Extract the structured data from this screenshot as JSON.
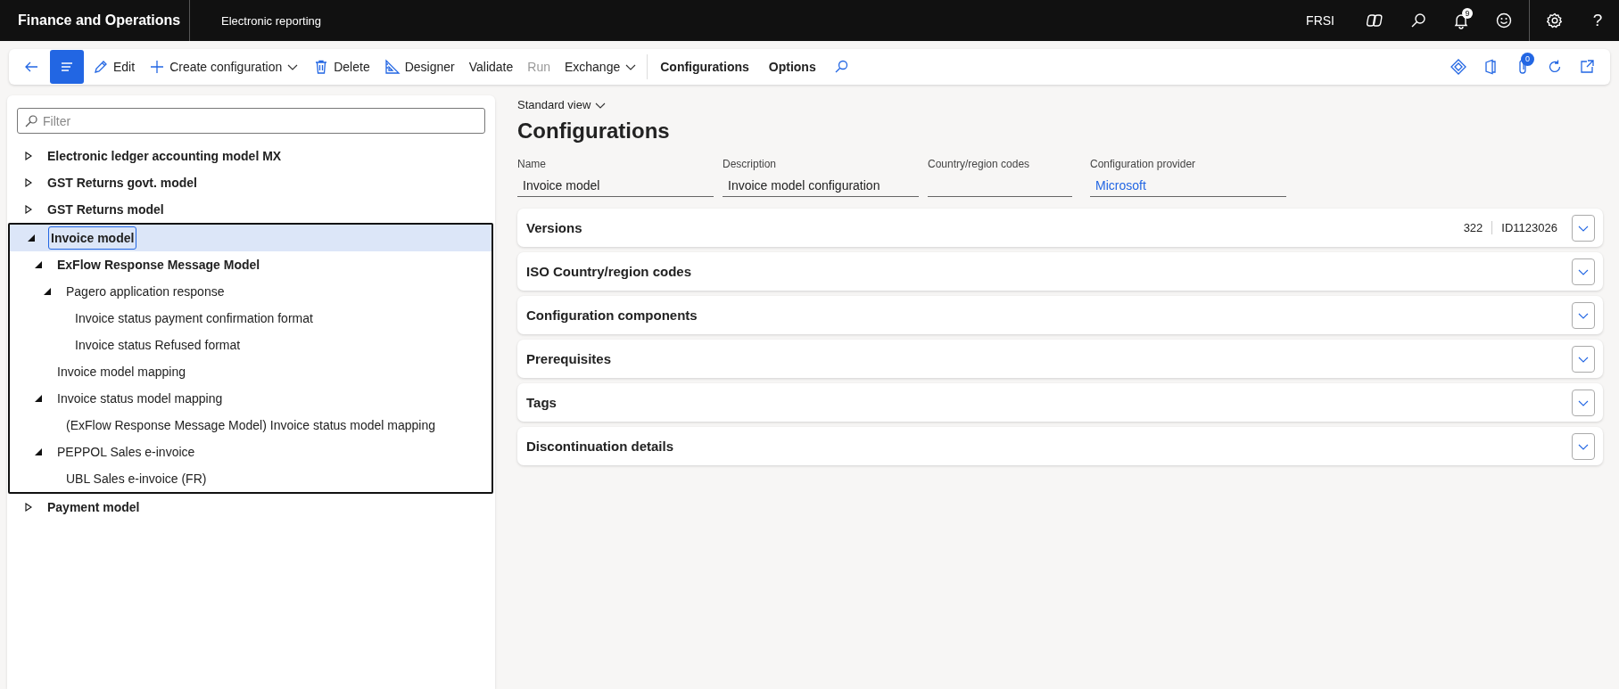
{
  "app": {
    "title": "Finance and Operations",
    "module": "Electronic reporting"
  },
  "top_bar": {
    "company": "FRSI",
    "notification_count": "9",
    "help": "?"
  },
  "toolbar": {
    "commands": [
      {
        "label": "Edit",
        "kind": "command",
        "disabled": false
      },
      {
        "label": "Create configuration",
        "kind": "menu",
        "disabled": false
      },
      {
        "label": "Delete",
        "kind": "command",
        "disabled": false
      },
      {
        "label": "Designer",
        "kind": "command",
        "disabled": false
      },
      {
        "label": "Validate",
        "kind": "plain",
        "disabled": false
      },
      {
        "label": "Run",
        "kind": "plain",
        "disabled": true
      },
      {
        "label": "Exchange",
        "kind": "menu",
        "disabled": false
      }
    ],
    "tabs": [
      "Configurations",
      "Options"
    ],
    "attachment_count": "0"
  },
  "filter": {
    "placeholder": "Filter"
  },
  "tree": [
    {
      "label": "Electronic ledger accounting model MX",
      "kind": "branch",
      "expanded": false,
      "emphasized": true,
      "selected": false
    },
    {
      "label": "GST Returns govt. model",
      "kind": "branch",
      "expanded": false,
      "emphasized": true,
      "selected": false
    },
    {
      "label": "GST Returns model",
      "kind": "branch",
      "expanded": false,
      "emphasized": true,
      "selected": false
    },
    {
      "label": "Invoice model",
      "kind": "branch",
      "expanded": true,
      "emphasized": true,
      "selected": true,
      "children": [
        {
          "label": "ExFlow Response Message Model",
          "kind": "branch",
          "expanded": true,
          "emphasized": true,
          "selected": false,
          "children": [
            {
              "label": "Pagero application response",
              "kind": "branch",
              "expanded": true,
              "emphasized": false,
              "selected": false,
              "children": [
                {
                  "label": "Invoice status payment confirmation format",
                  "kind": "leaf",
                  "emphasized": false,
                  "selected": false
                },
                {
                  "label": "Invoice status Refused format",
                  "kind": "leaf",
                  "emphasized": false,
                  "selected": false
                }
              ]
            }
          ]
        },
        {
          "label": "Invoice model mapping",
          "kind": "leaf",
          "emphasized": false,
          "selected": false
        },
        {
          "label": "Invoice status model mapping",
          "kind": "branch",
          "expanded": true,
          "emphasized": false,
          "selected": false,
          "children": [
            {
              "label": "(ExFlow Response Message Model) Invoice status model mapping",
              "kind": "leaf",
              "emphasized": false,
              "selected": false
            }
          ]
        },
        {
          "label": "PEPPOL Sales e-invoice",
          "kind": "branch",
          "expanded": true,
          "emphasized": false,
          "selected": false,
          "children": [
            {
              "label": "UBL Sales e-invoice (FR)",
              "kind": "leaf",
              "emphasized": false,
              "selected": false
            }
          ]
        }
      ]
    },
    {
      "label": "Payment model",
      "kind": "branch",
      "expanded": false,
      "emphasized": true,
      "selected": false
    }
  ],
  "form": {
    "view": "Standard view",
    "title": "Configurations",
    "fields": [
      {
        "label": "Name",
        "value": "Invoice model",
        "kind": "text"
      },
      {
        "label": "Description",
        "value": "Invoice model configuration",
        "kind": "text"
      },
      {
        "label": "Country/region codes",
        "kind": "text"
      },
      {
        "label": "Configuration provider",
        "value": "Microsoft",
        "kind": "link"
      }
    ]
  },
  "sections": [
    {
      "title": "Versions",
      "expanded": false,
      "summary": [
        "322",
        "ID1123026"
      ]
    },
    {
      "title": "ISO Country/region codes",
      "expanded": false
    },
    {
      "title": "Configuration components",
      "expanded": false
    },
    {
      "title": "Prerequisites",
      "expanded": false
    },
    {
      "title": "Tags",
      "expanded": false
    },
    {
      "title": "Discontinuation details",
      "expanded": false
    }
  ]
}
